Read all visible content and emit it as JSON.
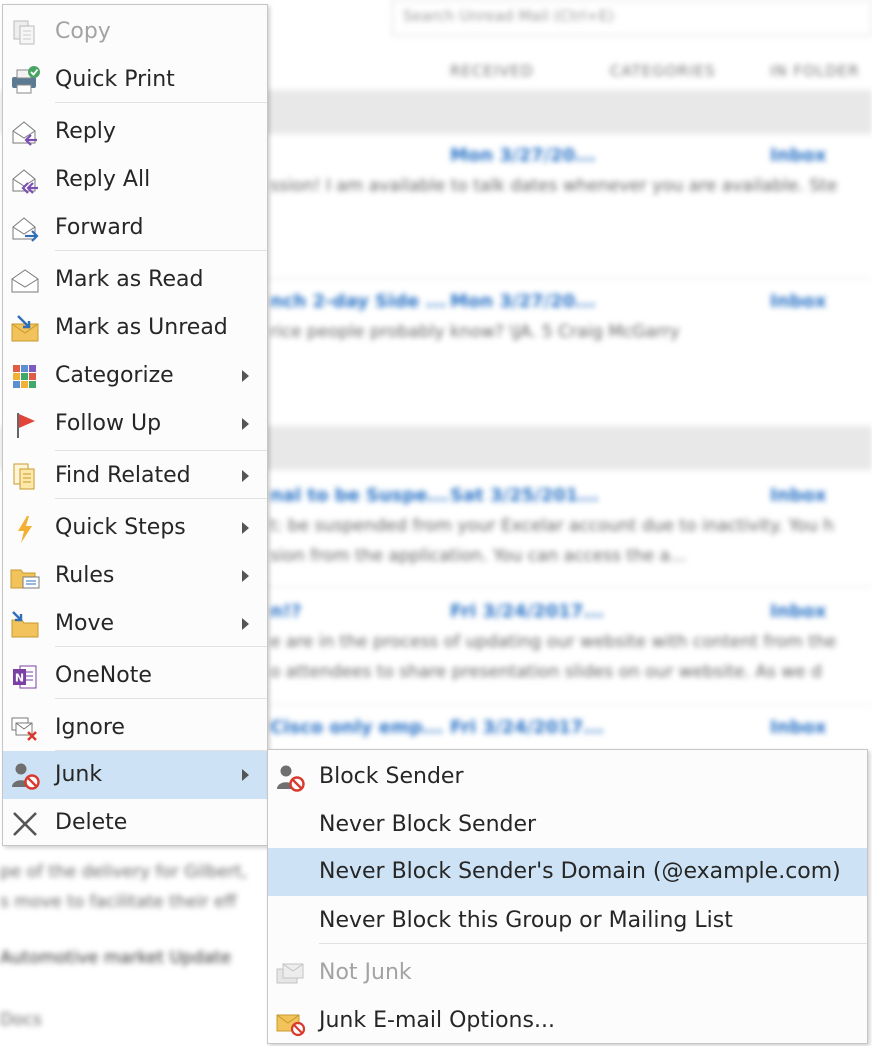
{
  "background": {
    "search_placeholder": "Search Unread Mail (Ctrl+E)",
    "columns": [
      "RECEIVED",
      "CATEGORIES",
      "IN FOLDER"
    ],
    "rows": [
      {
        "subject": "",
        "date": "Mon 3/27/20...",
        "folder": "Inbox",
        "preview": "ssion! I am available to talk dates whenever you are available.  Ste"
      },
      {
        "subject": "nch 2-day Side ...",
        "date": "Mon 3/27/20...",
        "folder": "Inbox",
        "preview": "rice people probably know?  \\JA.  5 Craig McGarry"
      },
      {
        "subject": "nal to be Suspe...",
        "date": "Sat 3/25/201...",
        "folder": "Inbox",
        "preview": "t: be suspended from your Excelar account due to inactivity. You h"
      },
      {
        "subject": "",
        "date": "",
        "folder": "",
        "preview": "sion from the application.  You can access the a..."
      },
      {
        "subject": "n!?",
        "date": "Fri 3/24/2017...",
        "folder": "Inbox",
        "preview": "e are in the process of updating our website with content from the"
      },
      {
        "subject": "",
        "date": "",
        "folder": "",
        "preview": "o attendees to share presentation slides on our website. As we d"
      },
      {
        "subject": "Cisco only emp...",
        "date": "Fri 3/24/2017...",
        "folder": "Inbox",
        "preview": ""
      }
    ],
    "lower_lines": [
      "pe of the delivery for Gilbert,",
      "s move to facilitate their eff",
      "Automotive market Update",
      "Docs"
    ]
  },
  "context_menu": {
    "items": [
      {
        "label": "Copy",
        "icon": "copy-icon"
      },
      {
        "label": "Quick Print",
        "icon": "quick-print-icon"
      },
      {
        "label": "Reply",
        "icon": "reply-icon"
      },
      {
        "label": "Reply All",
        "icon": "reply-all-icon"
      },
      {
        "label": "Forward",
        "icon": "forward-icon"
      },
      {
        "label": "Mark as Read",
        "icon": "mark-read-icon"
      },
      {
        "label": "Mark as Unread",
        "icon": "mark-unread-icon"
      },
      {
        "label": "Categorize",
        "icon": "categorize-icon"
      },
      {
        "label": "Follow Up",
        "icon": "flag-icon"
      },
      {
        "label": "Find Related",
        "icon": "find-related-icon"
      },
      {
        "label": "Quick Steps",
        "icon": "lightning-icon"
      },
      {
        "label": "Rules",
        "icon": "rules-icon"
      },
      {
        "label": "Move",
        "icon": "move-folder-icon"
      },
      {
        "label": "OneNote",
        "icon": "onenote-icon"
      },
      {
        "label": "Ignore",
        "icon": "ignore-icon"
      },
      {
        "label": "Junk",
        "icon": "junk-icon"
      },
      {
        "label": "Delete",
        "icon": "delete-icon"
      }
    ]
  },
  "junk_submenu": {
    "items": [
      {
        "label": "Block Sender",
        "icon": "block-sender-icon"
      },
      {
        "label": "Never Block Sender"
      },
      {
        "label": "Never Block Sender's Domain (@example.com)"
      },
      {
        "label": "Never Block this Group or Mailing List"
      },
      {
        "label": "Not Junk",
        "icon": "not-junk-icon"
      },
      {
        "label": "Junk E-mail Options...",
        "icon": "junk-options-icon"
      }
    ]
  },
  "colors": {
    "highlight": "#cde3f5",
    "disabled_text": "#a3a3a3",
    "link_blue": "#2b74c7"
  }
}
